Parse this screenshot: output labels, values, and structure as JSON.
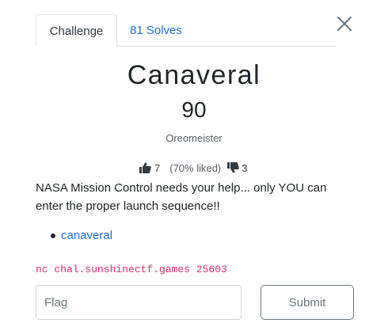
{
  "tabs": {
    "challenge_label": "Challenge",
    "solves_label": "81 Solves"
  },
  "challenge": {
    "name": "Canaveral",
    "points": "90",
    "author": "Oreomeister",
    "rating": {
      "likes": "7",
      "liked_text": "(70% liked)",
      "dislikes": "3"
    },
    "description": "NASA Mission Control needs your help... only YOU can enter the proper launch sequence!!",
    "files": [
      "canaveral"
    ],
    "connection": "nc chal.sunshinectf.games 25603"
  },
  "form": {
    "flag_placeholder": "Flag",
    "submit_label": "Submit"
  },
  "icons": {
    "close": "close-icon",
    "like": "thumbs-up-icon",
    "dislike": "thumbs-down-icon"
  },
  "colors": {
    "link": "#1e6fd0",
    "code": "#d6336c",
    "border": "#dee2e6"
  }
}
